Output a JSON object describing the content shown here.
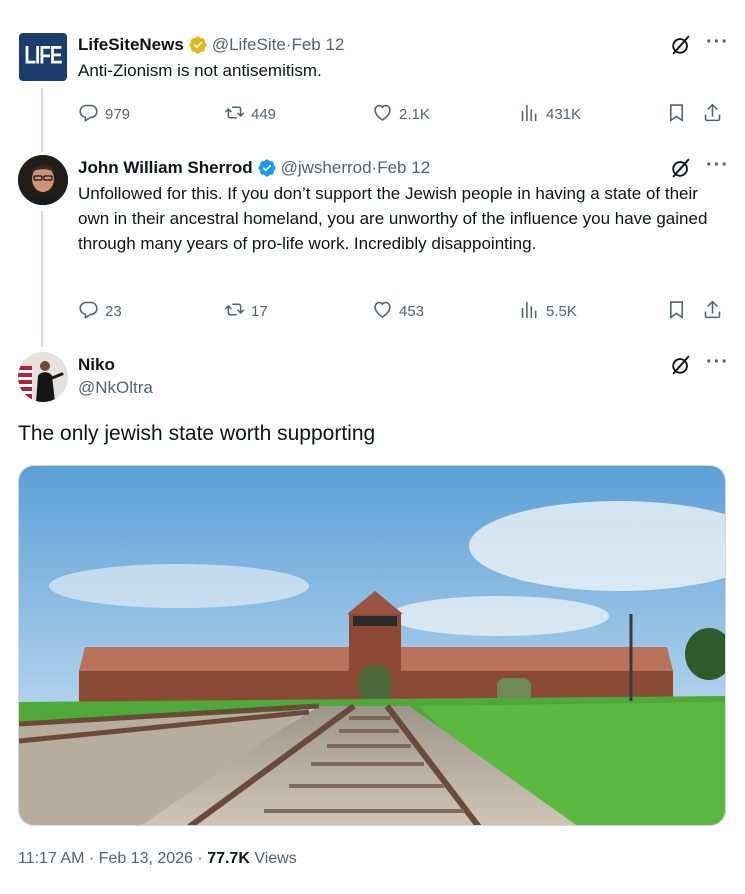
{
  "tweets": [
    {
      "name": "LifeSiteNews",
      "handle": "@LifeSite",
      "date": "Feb 12",
      "avatar_text": "LIFE",
      "text": "Anti-Zionism is not antisemitism.",
      "replies": "979",
      "reposts": "449",
      "likes": "2.1K",
      "views": "431K",
      "badge_color": "#e2b719"
    },
    {
      "name": "John William Sherrod",
      "handle": "@jwsherrod",
      "date": "Feb 12",
      "text": "Unfollowed for this. If you don’t support the Jewish people in having a state of their own in their ancestral homeland, you are unworthy of the influence you have gained through many years of pro-life work. Incredibly disappointing.",
      "replies": "23",
      "reposts": "17",
      "likes": "453",
      "views": "5.5K",
      "badge_color": "#1d9bf0"
    }
  ],
  "main": {
    "name": "Niko",
    "handle": "@NkOltra",
    "text": "The only jewish state worth supporting"
  },
  "footer": {
    "time": "11:17 AM",
    "date": "Feb 13, 2026",
    "views_count": "77.7K",
    "views_label": "Views"
  },
  "separator": "·",
  "more_glyph": "···",
  "icons": [
    "grok-icon",
    "more-icon",
    "reply-icon",
    "repost-icon",
    "like-icon",
    "views-icon",
    "bookmark-icon",
    "share-icon",
    "verified-icon"
  ],
  "colors": {
    "text": "#0f1419",
    "secondary": "#536471",
    "verified_blue": "#1d9bf0",
    "verified_gold": "#e2b719",
    "line": "#cfd9de"
  }
}
